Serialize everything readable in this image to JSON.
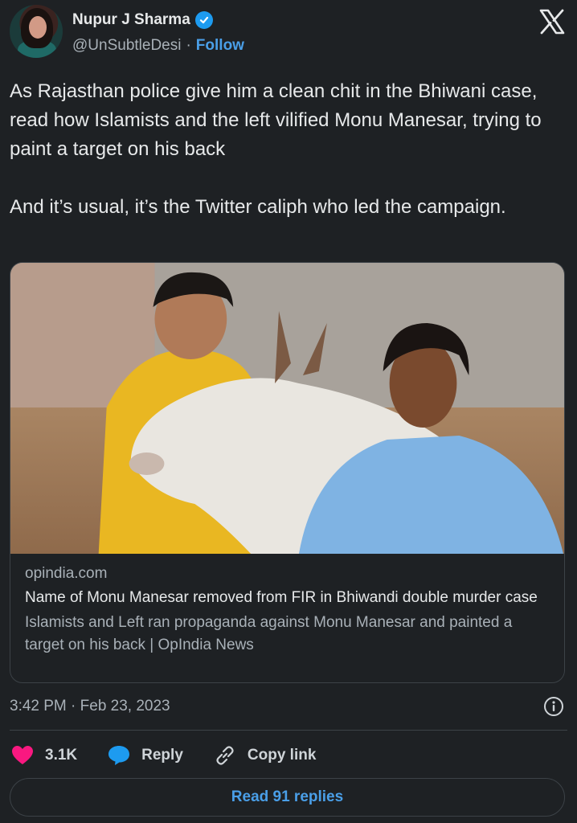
{
  "author": {
    "display_name": "Nupur J Sharma",
    "handle": "@UnSubtleDesi",
    "separator": "·",
    "follow_label": "Follow",
    "verified": true
  },
  "tweet": {
    "text": "As Rajasthan police give him a clean chit in the Bhiwani case, read how Islamists and the left vilified Monu Manesar, trying to paint a target on his back\n\nAnd it’s usual, it’s the Twitter caliph who led the campaign.",
    "timestamp": "3:42 PM · Feb 23, 2023"
  },
  "card": {
    "domain": "opindia.com",
    "title": "Name of Monu Manesar removed from FIR in Bhiwandi double murder case",
    "description": "Islamists and Left ran propaganda against Monu Manesar and painted a target on his back | OpIndia News"
  },
  "actions": {
    "like_count": "3.1K",
    "reply_label": "Reply",
    "copy_link_label": "Copy link"
  },
  "footer": {
    "read_replies_label": "Read 91 replies"
  },
  "colors": {
    "background": "#1e2124",
    "accent_blue": "#1d9bf0",
    "like_pink": "#f91880",
    "muted_text": "#a9b1b8"
  },
  "icons": {
    "verified": "verified-badge-icon",
    "brand": "x-logo-icon",
    "info": "info-icon",
    "like": "heart-icon",
    "reply": "speech-bubble-icon",
    "copy_link": "link-icon"
  }
}
